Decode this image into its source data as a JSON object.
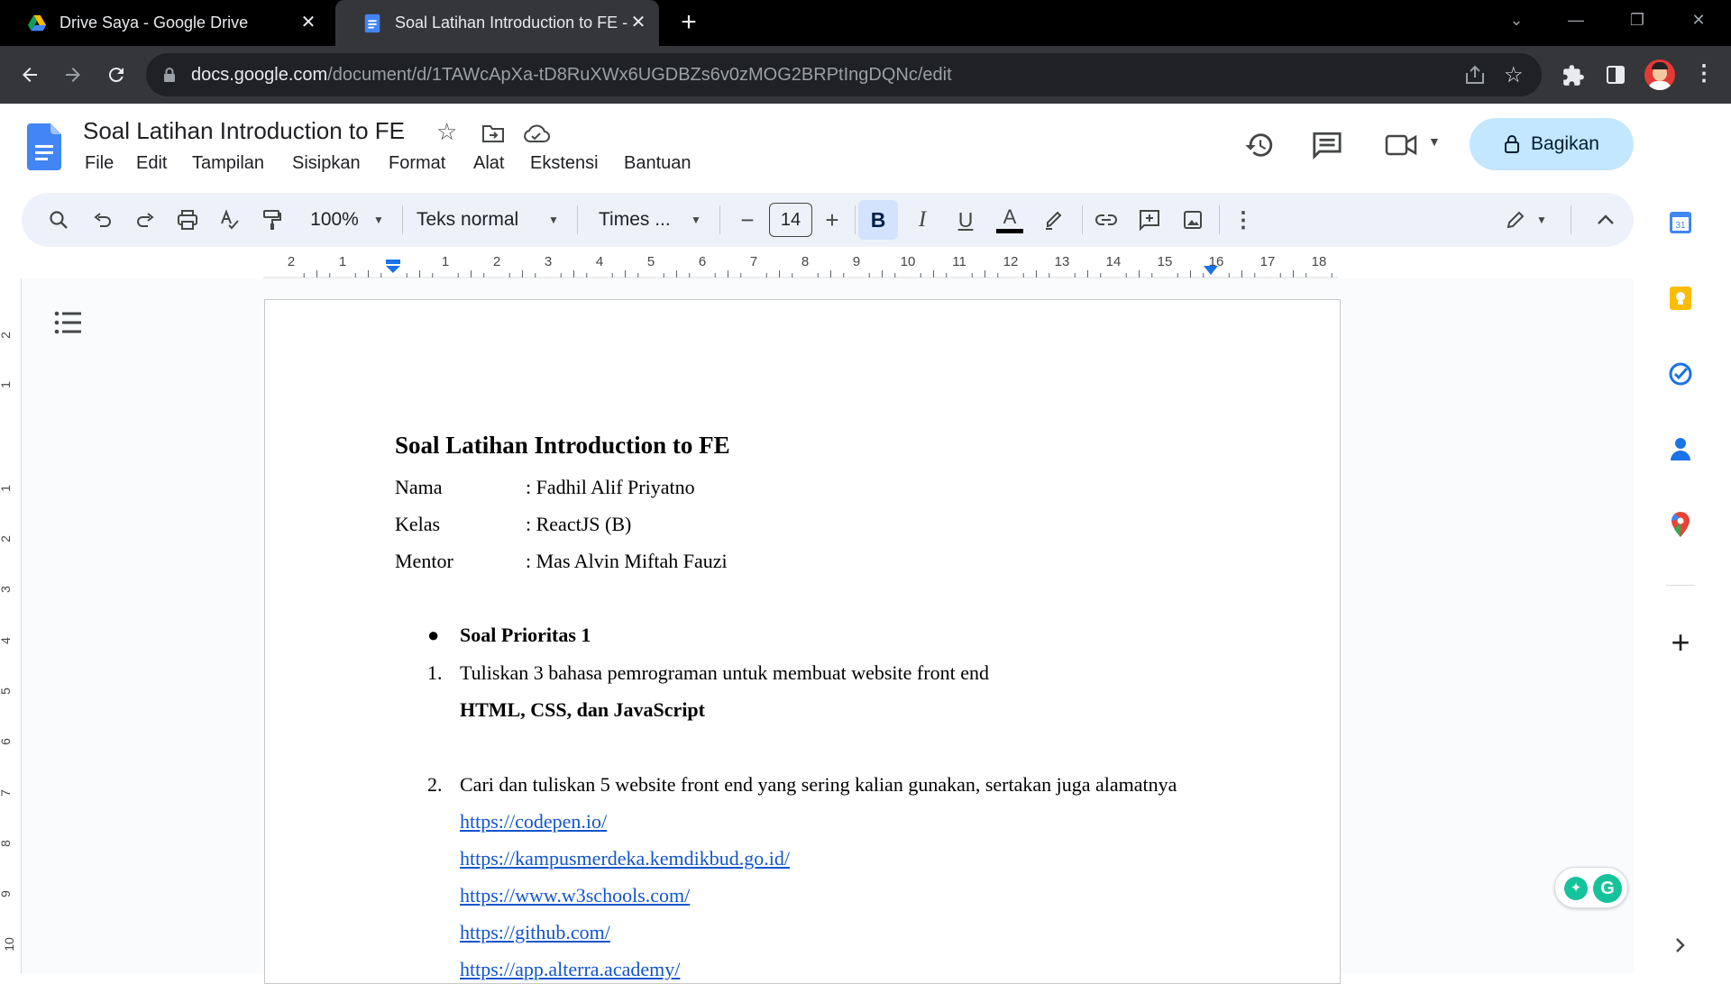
{
  "browser": {
    "tabs": [
      {
        "title": "Drive Saya - Google Drive"
      },
      {
        "title": "Soal Latihan Introduction to FE - "
      }
    ],
    "url_host": "docs.google.com",
    "url_path": "/document/d/1TAWcApXa-tD8RuXWx6UGDBZs6v0zMOG2BRPtIngDQNc/edit"
  },
  "docs": {
    "title": "Soal Latihan Introduction to FE",
    "menu": [
      "File",
      "Edit",
      "Tampilan",
      "Sisipkan",
      "Format",
      "Alat",
      "Ekstensi",
      "Bantuan"
    ],
    "share_label": "Bagikan"
  },
  "toolbar": {
    "zoom": "100%",
    "style": "Teks normal",
    "font": "Times ...",
    "font_size": "14"
  },
  "ruler": {
    "labels": [
      "2",
      "1",
      "1",
      "2",
      "3",
      "4",
      "5",
      "6",
      "7",
      "8",
      "9",
      "10",
      "11",
      "12",
      "13",
      "14",
      "15",
      "16",
      "17",
      "18"
    ]
  },
  "vruler": {
    "labels": [
      "2",
      "1",
      "1",
      "2",
      "3",
      "4",
      "5",
      "6",
      "7",
      "8",
      "9",
      "10"
    ]
  },
  "document": {
    "heading": "Soal Latihan Introduction to FE",
    "fields": [
      {
        "label": "Nama",
        "value": ": Fadhil Alif Priyatno"
      },
      {
        "label": "Kelas",
        "value": ": ReactJS (B)"
      },
      {
        "label": "Mentor",
        "value": ": Mas Alvin Miftah Fauzi"
      }
    ],
    "bullet": "Soal Prioritas 1",
    "q1_num": "1.",
    "q1": "Tuliskan 3 bahasa pemrograman untuk membuat website front end",
    "a1": "HTML, CSS, dan JavaScript",
    "q2_num": "2.",
    "q2": "Cari dan tuliskan 5 website front end yang sering kalian gunakan, sertakan juga alamatnya",
    "links": [
      "https://codepen.io/",
      "https://kampusmerdeka.kemdikbud.go.id/",
      "https://www.w3schools.com/",
      "https://github.com/",
      "https://app.alterra.academy/"
    ]
  },
  "colors": {
    "accent": "#1a73e8",
    "share_bg": "#c2e7ff",
    "toolbar_bg": "#edf2fa",
    "link": "#1155cc"
  }
}
